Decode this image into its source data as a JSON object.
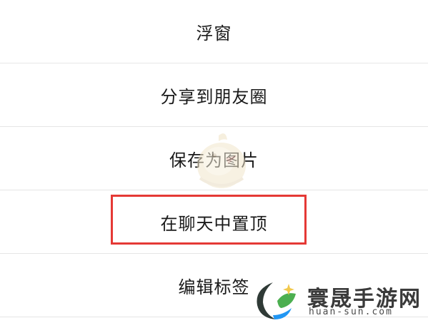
{
  "menu": {
    "items": [
      {
        "label": "浮窗"
      },
      {
        "label": "分享到朋友圈"
      },
      {
        "label": "保存为图片"
      },
      {
        "label": "在聊天中置顶"
      },
      {
        "label": "编辑标签"
      }
    ]
  },
  "highlight": {
    "target": "在聊天中置顶",
    "color": "#e53935"
  },
  "watermark": {
    "site_name": "寰晟手游网",
    "site_url": "huan-sun.com",
    "logo_icon": "leaf-logo-icon",
    "mascot_icon": "bird-mascot-icon"
  },
  "colors": {
    "text": "#1a1a1a",
    "divider": "#e6e6e6",
    "background": "#ffffff"
  }
}
